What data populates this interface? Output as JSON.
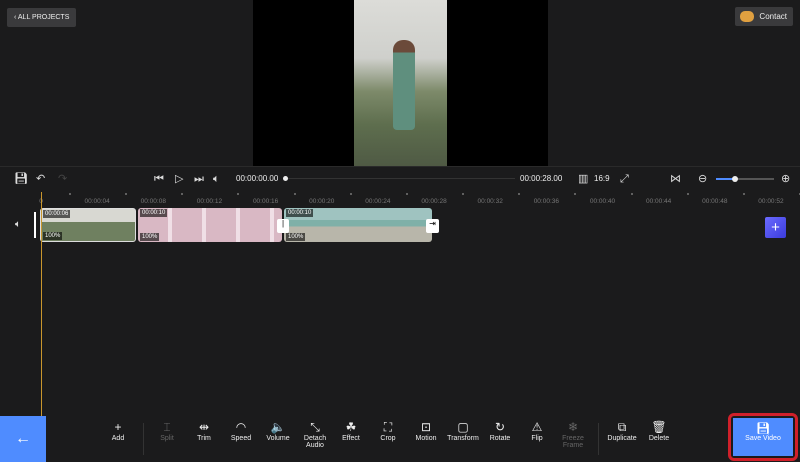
{
  "header": {
    "all_projects": "ALL PROJECTS",
    "contact": "Contact"
  },
  "player": {
    "current_time": "00:00:00.00",
    "total_time": "00:00:28.00",
    "aspect": "16:9",
    "zoom_level": 0.3
  },
  "ruler": [
    "0",
    "00:00:04",
    "00:00:08",
    "00:00:12",
    "00:00:16",
    "00:00:20",
    "00:00:24",
    "00:00:28",
    "00:00:32",
    "00:00:36",
    "00:00:40",
    "00:00:44",
    "00:00:48",
    "00:00:52"
  ],
  "clips": [
    {
      "duration": "00:00:06",
      "volume": "100%"
    },
    {
      "duration": "00:00:10",
      "volume": "100%"
    },
    {
      "duration": "00:00:10",
      "volume": "100%"
    }
  ],
  "tools": [
    {
      "label": "Add",
      "icon": "+"
    },
    {
      "label": "Split",
      "icon": "⌶",
      "disabled": true
    },
    {
      "label": "Trim",
      "icon": "⇹"
    },
    {
      "label": "Speed",
      "icon": "◠"
    },
    {
      "label": "Volume",
      "icon": "🔈"
    },
    {
      "label": "Detach Audio",
      "icon": "⤡"
    },
    {
      "label": "Effect",
      "icon": "☘"
    },
    {
      "label": "Crop",
      "icon": "⛶"
    },
    {
      "label": "Motion",
      "icon": "⊡"
    },
    {
      "label": "Transform",
      "icon": "▢"
    },
    {
      "label": "Rotate",
      "icon": "↻"
    },
    {
      "label": "Flip",
      "icon": "⚠"
    },
    {
      "label": "Freeze Frame",
      "icon": "❄",
      "disabled": true
    },
    {
      "label": "Duplicate",
      "icon": "⧉"
    },
    {
      "label": "Delete",
      "icon": "🗑"
    }
  ],
  "save": "Save Video",
  "colors": {
    "accent": "#4f8cff",
    "playhead": "#c9962d",
    "highlight": "#e02020"
  }
}
